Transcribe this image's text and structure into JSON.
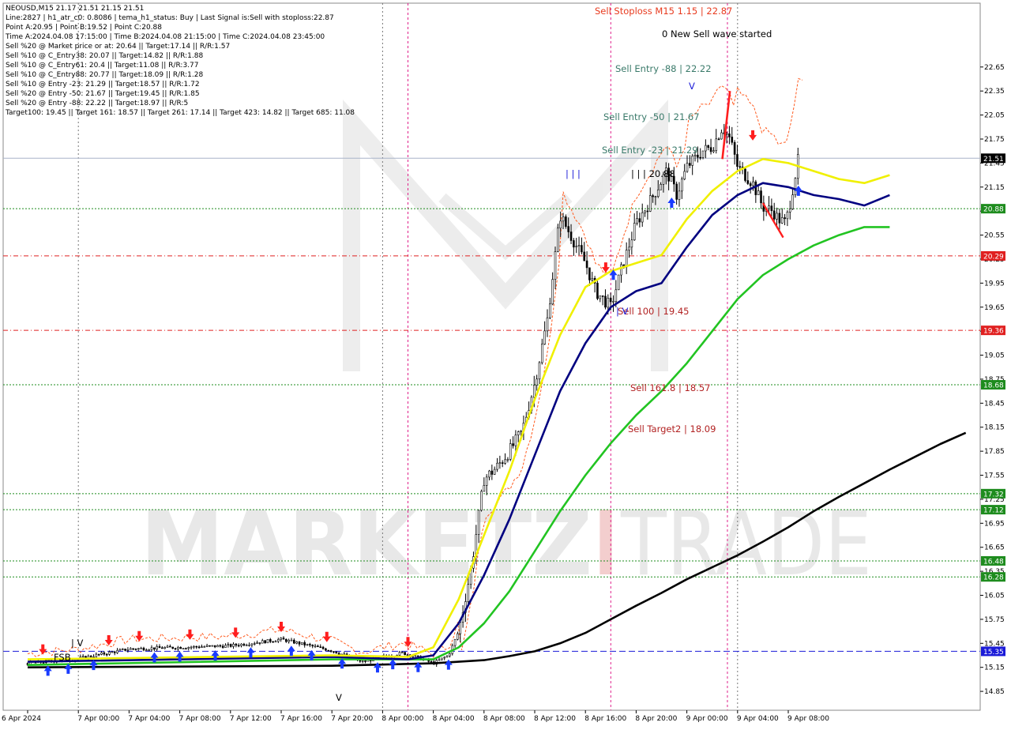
{
  "header": {
    "lines": [
      "NEOUSD,M15  21.17 21.51 21.15 21.51",
      "Line:2827  |  h1_atr_c0: 0.8086  |  tema_h1_status: Buy  |  Last Signal is:Sell with stoploss:22.87",
      "Point A:20.95  |  Point B:19.52  |  Point C:20.88",
      "Time A:2024.04.08 17:15:00  |  Time B:2024.04.08 21:15:00  |  Time C:2024.04.08 23:45:00",
      "Sell %20 @ Market price or at: 20.64  ||  Target:17.14  ||  R/R:1.57",
      "Sell %10 @ C_Entry38: 20.07  ||  Target:14.82  ||  R/R:1.88",
      "Sell %10 @ C_Entry61: 20.4  ||  Target:11.08  ||  R/R:3.77",
      "Sell %10 @ C_Entry88: 20.77  ||  Target:18.09  ||  R/R:1.28",
      "Sell %10 @ Entry -23: 21.29  ||  Target:18.57  ||  R/R:1.72",
      "Sell %20 @ Entry -50: 21.67  ||  Target:19.45  ||  R/R:1.85",
      "Sell %20 @ Entry -88: 22.22  ||  Target:18.97  ||  R/R:5",
      "Target100: 19.45  ||  Target 161: 18.57  ||  Target 261: 17.14  ||  Target 423: 14.82  ||  Target 685: 11.08"
    ]
  },
  "watermark": {
    "brand_left": "MARKETZ",
    "brand_i": "I",
    "brand_right": "TRADE"
  },
  "chart_data": {
    "type": "candlestick",
    "symbol": "NEOUSD",
    "timeframe": "M15",
    "ylim": [
      14.7,
      22.8
    ],
    "y_ticks": [
      "22.65",
      "22.35",
      "22.05",
      "21.75",
      "21.45",
      "21.15",
      "20.85",
      "20.55",
      "20.25",
      "19.95",
      "19.65",
      "19.35",
      "19.05",
      "18.75",
      "18.45",
      "18.15",
      "17.85",
      "17.55",
      "17.25",
      "16.95",
      "16.65",
      "16.35",
      "16.05",
      "15.75",
      "15.45",
      "15.15",
      "14.85"
    ],
    "x_ticks": [
      "6 Apr 2024",
      "7 Apr 00:00",
      "7 Apr 04:00",
      "7 Apr 08:00",
      "7 Apr 12:00",
      "7 Apr 16:00",
      "7 Apr 20:00",
      "8 Apr 00:00",
      "8 Apr 04:00",
      "8 Apr 08:00",
      "8 Apr 12:00",
      "8 Apr 16:00",
      "8 Apr 20:00",
      "9 Apr 00:00",
      "9 Apr 04:00",
      "9 Apr 08:00"
    ],
    "price_badges": [
      {
        "label": "21.51",
        "value": 21.51,
        "color": "#000000"
      },
      {
        "label": "20.88",
        "value": 20.88,
        "color": "#1e8c1e"
      },
      {
        "label": "20.29",
        "value": 20.29,
        "color": "#e02020"
      },
      {
        "label": "19.36",
        "value": 19.36,
        "color": "#e02020"
      },
      {
        "label": "18.68",
        "value": 18.68,
        "color": "#1e8c1e"
      },
      {
        "label": "17.32",
        "value": 17.32,
        "color": "#1e8c1e"
      },
      {
        "label": "17.12",
        "value": 17.12,
        "color": "#1e8c1e"
      },
      {
        "label": "16.48",
        "value": 16.48,
        "color": "#1e8c1e"
      },
      {
        "label": "16.28",
        "value": 16.28,
        "color": "#1e8c1e"
      },
      {
        "label": "15.35",
        "value": 15.35,
        "color": "#1a1ad8"
      }
    ],
    "levels": [
      {
        "value": 21.51,
        "style": "solid",
        "color": "#a9b3c9"
      },
      {
        "value": 20.88,
        "style": "dotted",
        "color": "#1e8c1e"
      },
      {
        "value": 20.29,
        "style": "dashdot",
        "color": "#e02020"
      },
      {
        "value": 19.36,
        "style": "dashdot",
        "color": "#e02020"
      },
      {
        "value": 18.68,
        "style": "dotted",
        "color": "#1e8c1e"
      },
      {
        "value": 17.32,
        "style": "dotted",
        "color": "#1e8c1e"
      },
      {
        "value": 17.12,
        "style": "dotted",
        "color": "#1e8c1e"
      },
      {
        "value": 16.48,
        "style": "dotted",
        "color": "#1e8c1e"
      },
      {
        "value": 16.28,
        "style": "dotted",
        "color": "#1e8c1e"
      },
      {
        "value": 15.35,
        "style": "dashed",
        "color": "#1a1ad8"
      }
    ],
    "annotations": [
      {
        "text": "Sell Stoploss M15 1.15 | 22.87",
        "color": "#e83a1e"
      },
      {
        "text": "0 New Sell wave started",
        "color": "#000000"
      },
      {
        "text": "Sell Entry -88 | 22.22",
        "color": "#3a7a6a"
      },
      {
        "text": "Sell Entry -50 | 21.67",
        "color": "#3a7a6a"
      },
      {
        "text": "Sell Entry -23 | 21.29",
        "color": "#3a7a6a"
      },
      {
        "text": "| | | 20.88",
        "color": "#000000"
      },
      {
        "text": "Sell 100 | 19.45",
        "color": "#b22222"
      },
      {
        "text": "Sell 161.8 | 18.57",
        "color": "#b22222"
      },
      {
        "text": "Sell Target2 | 18.09",
        "color": "#b22222"
      },
      {
        "text": "FSB",
        "color": "#000000"
      },
      {
        "text": "| V",
        "color": "#000000"
      },
      {
        "text": "V",
        "color": "#000000"
      },
      {
        "text": "| | |",
        "color": "#1a1ad8"
      },
      {
        "text": "V",
        "color": "#1a1ad8"
      },
      {
        "text": "| V",
        "color": "#1a1ad8"
      }
    ],
    "series": [
      {
        "name": "",
        "color": "#000000",
        "points": [
          [
            0,
            15.15
          ],
          [
            6,
            15.17
          ],
          [
            8,
            15.2
          ],
          [
            9,
            15.24
          ],
          [
            9.5,
            15.29
          ],
          [
            10,
            15.35
          ],
          [
            10.5,
            15.45
          ],
          [
            11,
            15.58
          ],
          [
            11.5,
            15.75
          ],
          [
            12,
            15.92
          ],
          [
            12.5,
            16.08
          ],
          [
            13,
            16.25
          ],
          [
            13.5,
            16.4
          ],
          [
            14,
            16.55
          ],
          [
            14.5,
            16.72
          ],
          [
            15,
            16.9
          ],
          [
            15.5,
            17.1
          ],
          [
            16,
            17.28
          ],
          [
            16.5,
            17.45
          ],
          [
            17,
            17.62
          ],
          [
            17.5,
            17.78
          ],
          [
            18,
            17.94
          ],
          [
            18.5,
            18.08
          ]
        ]
      },
      {
        "name": "",
        "color": "#22c422",
        "points": [
          [
            0,
            15.18
          ],
          [
            6,
            15.25
          ],
          [
            8,
            15.25
          ],
          [
            8.5,
            15.4
          ],
          [
            9,
            15.7
          ],
          [
            9.5,
            16.1
          ],
          [
            10,
            16.6
          ],
          [
            10.5,
            17.1
          ],
          [
            11,
            17.55
          ],
          [
            11.5,
            17.95
          ],
          [
            12,
            18.3
          ],
          [
            12.5,
            18.6
          ],
          [
            13,
            18.95
          ],
          [
            13.5,
            19.35
          ],
          [
            14,
            19.75
          ],
          [
            14.5,
            20.05
          ],
          [
            15,
            20.25
          ],
          [
            15.5,
            20.42
          ],
          [
            16,
            20.55
          ],
          [
            16.5,
            20.65
          ],
          [
            17,
            20.65
          ]
        ]
      },
      {
        "name": "",
        "color": "#000080",
        "points": [
          [
            0,
            15.22
          ],
          [
            6,
            15.28
          ],
          [
            7.5,
            15.25
          ],
          [
            8,
            15.3
          ],
          [
            8.5,
            15.7
          ],
          [
            9,
            16.3
          ],
          [
            9.5,
            17.0
          ],
          [
            10,
            17.8
          ],
          [
            10.5,
            18.6
          ],
          [
            11,
            19.2
          ],
          [
            11.5,
            19.65
          ],
          [
            12,
            19.85
          ],
          [
            12.5,
            19.95
          ],
          [
            13,
            20.4
          ],
          [
            13.5,
            20.8
          ],
          [
            14,
            21.05
          ],
          [
            14.5,
            21.2
          ],
          [
            15,
            21.15
          ],
          [
            15.5,
            21.05
          ],
          [
            16,
            21.0
          ],
          [
            16.5,
            20.92
          ],
          [
            17,
            21.05
          ]
        ]
      },
      {
        "name": "",
        "color": "#f0f000",
        "points": [
          [
            0,
            15.25
          ],
          [
            6,
            15.3
          ],
          [
            7.5,
            15.28
          ],
          [
            8,
            15.4
          ],
          [
            8.5,
            16.0
          ],
          [
            9,
            16.8
          ],
          [
            9.5,
            17.6
          ],
          [
            10,
            18.5
          ],
          [
            10.5,
            19.3
          ],
          [
            11,
            19.9
          ],
          [
            11.5,
            20.1
          ],
          [
            12,
            20.2
          ],
          [
            12.5,
            20.3
          ],
          [
            13,
            20.75
          ],
          [
            13.5,
            21.1
          ],
          [
            14,
            21.35
          ],
          [
            14.5,
            21.5
          ],
          [
            15,
            21.45
          ],
          [
            15.5,
            21.35
          ],
          [
            16,
            21.25
          ],
          [
            16.5,
            21.2
          ],
          [
            17,
            21.3
          ]
        ]
      }
    ],
    "candles_overview": {
      "start": 15.2,
      "rally_high": 21.1,
      "peak_high": 22.38,
      "last_close": 21.51
    }
  }
}
